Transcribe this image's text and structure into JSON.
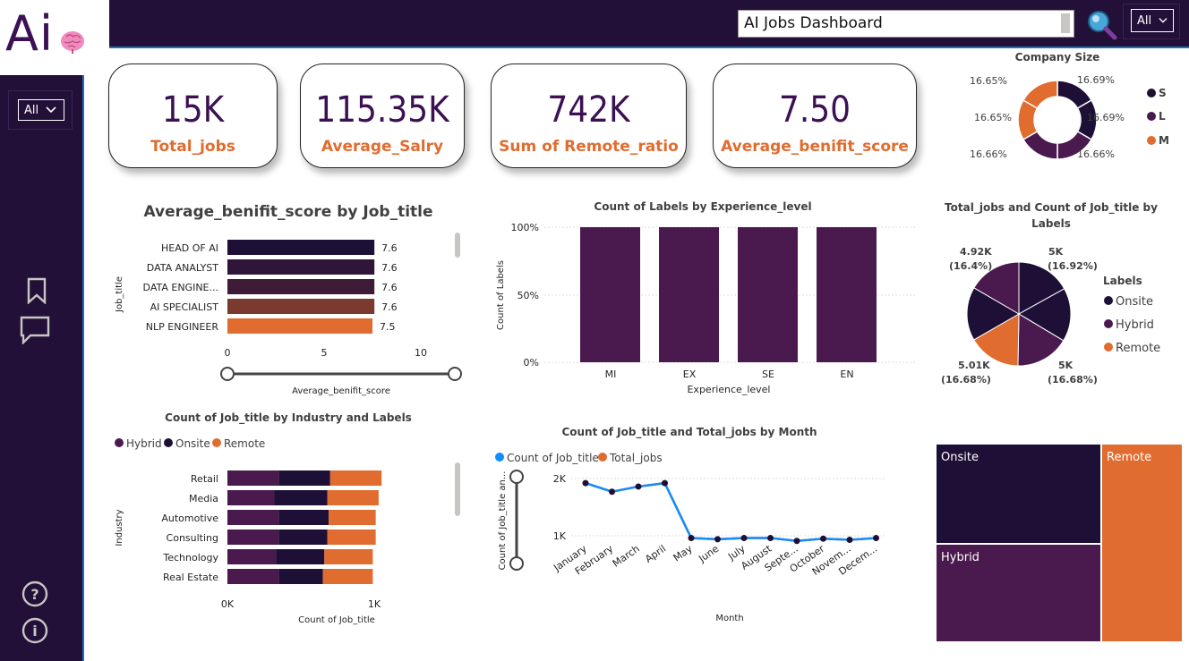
{
  "header": {
    "logo_text": "Ai",
    "search": {
      "value": "AI Jobs Dashboard"
    },
    "top_slicer": "All",
    "side_slicer": "All"
  },
  "colors": {
    "dark": "#1e0f36",
    "purple": "#4a1a4f",
    "orange": "#e06c2f",
    "navy": "#221038",
    "accent": "#1a73b8"
  },
  "kpis": [
    {
      "value": "15K",
      "label": "Total_jobs"
    },
    {
      "value": "115.35K",
      "label": "Average_Salry"
    },
    {
      "value": "742K",
      "label": "Sum of Remote_ratio"
    },
    {
      "value": "7.50",
      "label": "Average_benifit_score"
    }
  ],
  "chart_data": [
    {
      "id": "company-size",
      "type": "pie",
      "title": "Company Size",
      "labels": [
        "S",
        "L",
        "M"
      ],
      "colors": [
        "#1e0f36",
        "#4a1a4f",
        "#e06c2f"
      ],
      "values": [
        33.38,
        33.32,
        33.3
      ],
      "slice_labels": [
        "16.69%",
        "16.69%",
        "16.66%",
        "16.66%",
        "16.65%",
        "16.65%"
      ]
    },
    {
      "id": "benefit-by-title",
      "type": "bar",
      "title": "Average_benifit_score by Job_title",
      "categories": [
        "HEAD OF AI",
        "DATA ANALYST",
        "DATA ENGINE...",
        "AI SPECIALIST",
        "NLP ENGINEER"
      ],
      "values": [
        7.6,
        7.6,
        7.6,
        7.6,
        7.5
      ],
      "value_labels": [
        "7.6",
        "7.6",
        "7.6",
        "7.6",
        "7.5"
      ],
      "colors": [
        "#1e0f36",
        "#2f1538",
        "#3e1c37",
        "#7a3a30",
        "#e06c2f"
      ],
      "xlabel": "Average_benifit_score",
      "ylabel": "Job_title",
      "xlim": [
        0,
        10
      ],
      "xticks": [
        "0",
        "5",
        "10"
      ]
    },
    {
      "id": "labels-by-experience",
      "type": "bar",
      "title": "Count of Labels by Experience_level",
      "categories": [
        "MI",
        "EX",
        "SE",
        "EN"
      ],
      "values": [
        100,
        100,
        100,
        100
      ],
      "xlabel": "Experience_level",
      "ylabel": "Count of Labels",
      "ylim": [
        0,
        100
      ],
      "yticks": [
        "100%",
        "50%",
        "0%"
      ]
    },
    {
      "id": "jobs-by-labels",
      "type": "pie",
      "title": "Total_jobs and Count of Job_title by Labels",
      "legend_title": "Labels",
      "labels": [
        "Onsite",
        "Hybrid",
        "Remote"
      ],
      "colors": [
        "#1e0f36",
        "#4a1a4f",
        "#e06c2f"
      ],
      "slices": [
        {
          "value": 16.92,
          "label": "5K",
          "pct": "(16.92%)",
          "color": "#1e0f36"
        },
        {
          "value": 16.68,
          "label": "5K",
          "pct": "(16.68%)",
          "color": "#1e0f36"
        },
        {
          "value": 16.68,
          "label": "5.01K",
          "pct": "(16.68%)",
          "color": "#4a1a4f"
        },
        {
          "value": 16.4,
          "label": "4.92K",
          "pct": "(16.4%)",
          "color": "#e06c2f"
        },
        {
          "value": 16.7,
          "label": "",
          "pct": "",
          "color": "#1e0f36"
        },
        {
          "value": 16.6,
          "label": "",
          "pct": "",
          "color": "#4a1a4f"
        }
      ]
    },
    {
      "id": "jobs-by-industry",
      "type": "bar",
      "title": "Count of Job_title by Industry and Labels",
      "categories": [
        "Retail",
        "Media",
        "Automotive",
        "Consulting",
        "Technology",
        "Real Estate"
      ],
      "series": [
        {
          "name": "Hybrid",
          "color": "#4a1a4f",
          "values": [
            350,
            320,
            350,
            350,
            330,
            350
          ]
        },
        {
          "name": "Onsite",
          "color": "#1e0f36",
          "values": [
            350,
            360,
            340,
            330,
            330,
            300
          ]
        },
        {
          "name": "Remote",
          "color": "#e06c2f",
          "values": [
            350,
            350,
            320,
            330,
            330,
            340
          ]
        }
      ],
      "xlabel": "Count of Job_title",
      "ylabel": "Industry",
      "xlim": [
        0,
        1000
      ],
      "xticks": [
        "0K",
        "1K"
      ]
    },
    {
      "id": "jobs-by-month",
      "type": "line",
      "title": "Count of Job_title and Total_jobs by Month",
      "x": [
        "January",
        "February",
        "March",
        "April",
        "May",
        "June",
        "July",
        "August",
        "Septe...",
        "October",
        "Novem...",
        "Decem..."
      ],
      "series": [
        {
          "name": "Count of Job_title",
          "color": "#118dff",
          "values": [
            1920,
            1770,
            1860,
            1920,
            960,
            940,
            960,
            960,
            910,
            950,
            930,
            960
          ]
        },
        {
          "name": "Total_jobs",
          "color": "#e06c2f",
          "values": [
            1920,
            1770,
            1860,
            1920,
            960,
            940,
            960,
            960,
            910,
            950,
            930,
            960
          ]
        }
      ],
      "xlabel": "Month",
      "ylabel": "Count of Job_title an...",
      "ylim": [
        700,
        2100
      ],
      "yticks": [
        "2K",
        "1K"
      ]
    },
    {
      "id": "labels-treemap",
      "type": "heatmap",
      "labels": [
        "Onsite",
        "Remote",
        "Hybrid"
      ],
      "colors": [
        "#1e0f36",
        "#e06c2f",
        "#4a1a4f"
      ]
    }
  ]
}
